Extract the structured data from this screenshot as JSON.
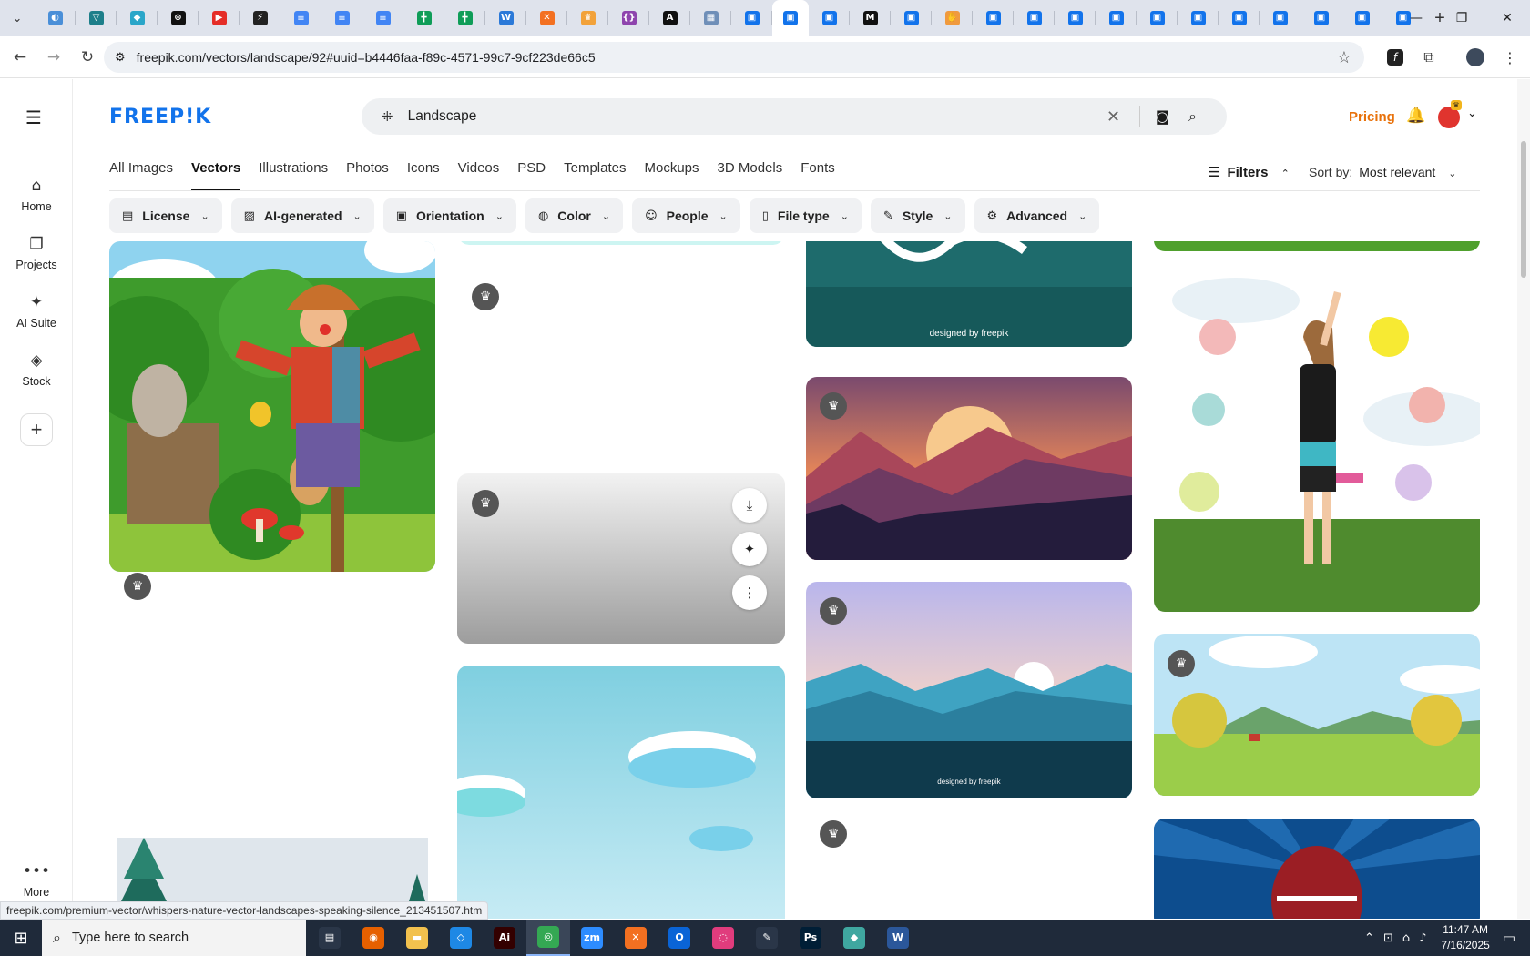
{
  "browser": {
    "url": "freepik.com/vectors/landscape/92#uuid=b4446faa-f89c-4571-99c7-9cf223de66c5",
    "tabs": [
      {
        "icon": "globe-icon",
        "color": "#4a8fd8"
      },
      {
        "icon": "vpn-icon",
        "color": "#1d7f8a"
      },
      {
        "icon": "copilot-icon",
        "color": "#2aa6c9"
      },
      {
        "icon": "openai-icon",
        "color": "#111111"
      },
      {
        "icon": "youtube-icon",
        "color": "#e52d27"
      },
      {
        "icon": "bolt-icon",
        "color": "#222222"
      },
      {
        "icon": "docs-icon",
        "color": "#4285f4"
      },
      {
        "icon": "docs-icon",
        "color": "#4285f4"
      },
      {
        "icon": "docs-icon",
        "color": "#4285f4"
      },
      {
        "icon": "sheets-icon",
        "color": "#0f9d58"
      },
      {
        "icon": "sheets-icon",
        "color": "#0f9d58"
      },
      {
        "icon": "word-icon",
        "color": "#2b79d8"
      },
      {
        "icon": "xampp-icon",
        "color": "#f37021"
      },
      {
        "icon": "crown-icon",
        "color": "#f2a23a"
      },
      {
        "icon": "code-icon",
        "color": "#8e44ad"
      },
      {
        "icon": "ai-icon",
        "color": "#111111"
      },
      {
        "icon": "table-icon",
        "color": "#6f8fb8"
      },
      {
        "icon": "freepik-icon",
        "color": "#1273eb"
      },
      {
        "icon": "freepik-icon",
        "color": "#1273eb",
        "active": true
      },
      {
        "icon": "freepik-icon",
        "color": "#1273eb"
      },
      {
        "icon": "m-icon",
        "color": "#111111"
      },
      {
        "icon": "freepik-icon",
        "color": "#1273eb"
      },
      {
        "icon": "hand-icon",
        "color": "#f09a3e"
      },
      {
        "icon": "freepik-icon",
        "color": "#1273eb"
      },
      {
        "icon": "freepik-icon",
        "color": "#1273eb"
      },
      {
        "icon": "freepik-icon",
        "color": "#1273eb"
      },
      {
        "icon": "freepik-icon",
        "color": "#1273eb"
      },
      {
        "icon": "freepik-icon",
        "color": "#1273eb"
      },
      {
        "icon": "freepik-icon",
        "color": "#1273eb"
      },
      {
        "icon": "freepik-icon",
        "color": "#1273eb"
      },
      {
        "icon": "freepik-icon",
        "color": "#1273eb"
      },
      {
        "icon": "freepik-icon",
        "color": "#1273eb"
      },
      {
        "icon": "freepik-icon",
        "color": "#1273eb"
      },
      {
        "icon": "freepik-icon",
        "color": "#1273eb"
      }
    ],
    "status_url": "freepik.com/premium-vector/whispers-nature-vector-landscapes-speaking-silence_213451507.htm"
  },
  "site": {
    "logo": "FREEP!K",
    "search_value": "Landscape",
    "pricing": "Pricing"
  },
  "rail": {
    "items": [
      {
        "label": "Home",
        "icon": "home-icon"
      },
      {
        "label": "Projects",
        "icon": "projects-icon"
      },
      {
        "label": "AI Suite",
        "icon": "sparkle-icon"
      },
      {
        "label": "Stock",
        "icon": "stock-icon"
      }
    ],
    "more": "More"
  },
  "tabs": [
    "All Images",
    "Vectors",
    "Illustrations",
    "Photos",
    "Icons",
    "Videos",
    "PSD",
    "Templates",
    "Mockups",
    "3D Models",
    "Fonts"
  ],
  "active_tab": "Vectors",
  "filters_label": "Filters",
  "sort": {
    "label": "Sort by:",
    "value": "Most relevant"
  },
  "chips": [
    {
      "label": "License",
      "icon": "license-icon"
    },
    {
      "label": "AI-generated",
      "icon": "ai-generated-icon"
    },
    {
      "label": "Orientation",
      "icon": "orientation-icon"
    },
    {
      "label": "Color",
      "icon": "palette-icon"
    },
    {
      "label": "People",
      "icon": "people-icon"
    },
    {
      "label": "File type",
      "icon": "file-icon"
    },
    {
      "label": "Style",
      "icon": "brush-icon"
    },
    {
      "label": "Advanced",
      "icon": "gear-icon"
    }
  ],
  "cards": {
    "caption": "designed by freepik"
  },
  "taskbar": {
    "search_placeholder": "Type here to search",
    "time": "11:47 AM",
    "date": "7/16/2025",
    "apps": [
      {
        "icon": "task-view-icon",
        "color": "#2a3648",
        "glyph": "▤"
      },
      {
        "icon": "firefox-icon",
        "color": "#e66000",
        "glyph": "◉"
      },
      {
        "icon": "explorer-icon",
        "color": "#f2c14e",
        "glyph": "▬"
      },
      {
        "icon": "vscode-icon",
        "color": "#1e88e5",
        "glyph": "◇"
      },
      {
        "icon": "illustrator-icon",
        "color": "#330000",
        "glyph": "Ai"
      },
      {
        "icon": "chrome-icon",
        "color": "#34a853",
        "glyph": "◎",
        "active": true
      },
      {
        "icon": "zoom-icon",
        "color": "#2d8cff",
        "glyph": "zm"
      },
      {
        "icon": "xampp-icon",
        "color": "#f37021",
        "glyph": "✕"
      },
      {
        "icon": "outlook-icon",
        "color": "#0a64d6",
        "glyph": "O"
      },
      {
        "icon": "creative-cloud-icon",
        "color": "#e03c7d",
        "glyph": "◌"
      },
      {
        "icon": "pen-icon",
        "color": "#2a3648",
        "glyph": "✎"
      },
      {
        "icon": "photoshop-icon",
        "color": "#001e36",
        "glyph": "Ps"
      },
      {
        "icon": "app-icon",
        "color": "#3fa7a0",
        "glyph": "◆"
      },
      {
        "icon": "word-icon",
        "color": "#2b579a",
        "glyph": "W"
      }
    ]
  }
}
